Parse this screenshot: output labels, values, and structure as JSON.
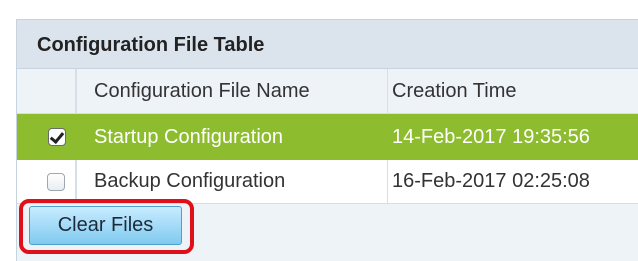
{
  "table": {
    "title": "Configuration File Table",
    "columns": [
      "",
      "Configuration File Name",
      "Creation Time"
    ],
    "rows": [
      {
        "checked": true,
        "name": "Startup Configuration",
        "time": "14-Feb-2017 19:35:56"
      },
      {
        "checked": false,
        "name": "Backup Configuration",
        "time": "16-Feb-2017 02:25:08"
      }
    ]
  },
  "actions": {
    "clear_files": "Clear Files"
  },
  "colors": {
    "selected_row": "#8dbd2f",
    "highlight_outline": "#e0101a",
    "button_fill": "#7fcaf0"
  }
}
